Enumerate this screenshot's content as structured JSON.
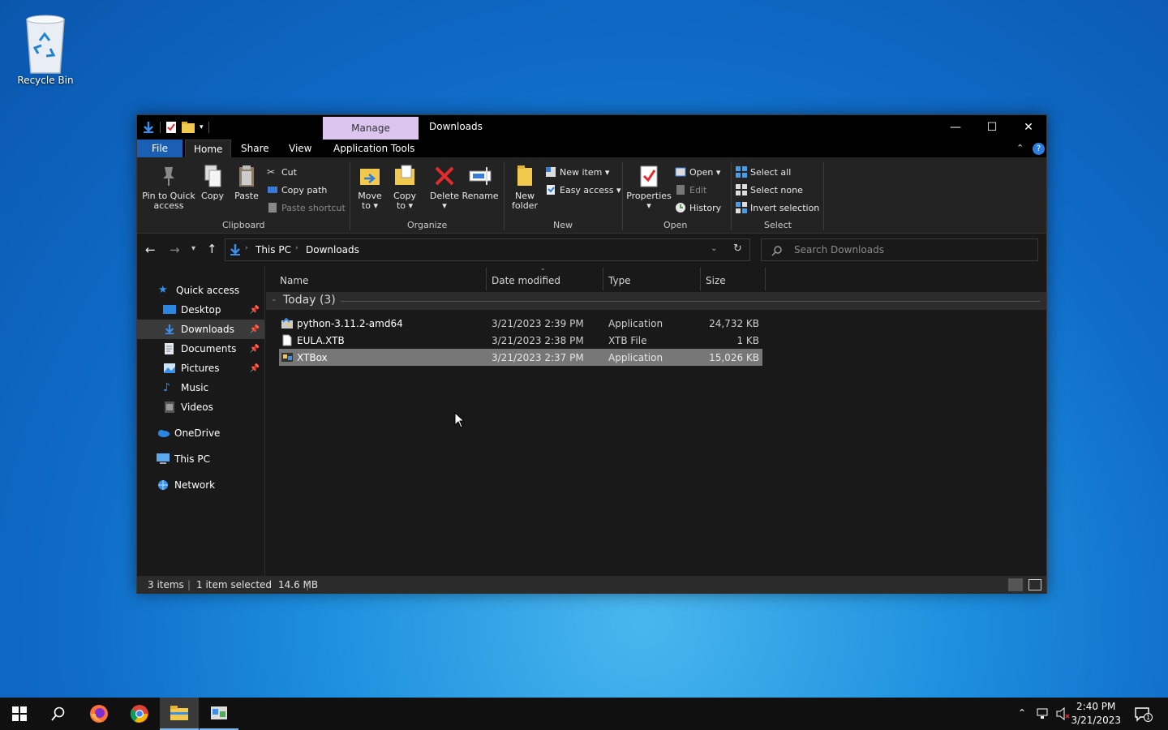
{
  "desktop": {
    "recycle_bin_label": "Recycle Bin"
  },
  "window": {
    "title": "Downloads",
    "context_tab": "Manage",
    "controls": {
      "minimize": "—",
      "maximize": "☐",
      "close": "✕"
    }
  },
  "ribbon_tabs": {
    "file": "File",
    "home": "Home",
    "share": "Share",
    "view": "View",
    "app_tools": "Application Tools"
  },
  "ribbon": {
    "clipboard": {
      "label": "Clipboard",
      "pin": "Pin to Quick\naccess",
      "copy": "Copy",
      "paste": "Paste",
      "cut": "Cut",
      "copy_path": "Copy path",
      "paste_shortcut": "Paste shortcut"
    },
    "organize": {
      "label": "Organize",
      "move_to": "Move\nto ▾",
      "copy_to": "Copy\nto ▾",
      "delete": "Delete\n▾",
      "rename": "Rename"
    },
    "new": {
      "label": "New",
      "new_folder": "New\nfolder",
      "new_item": "New item ▾",
      "easy_access": "Easy access ▾"
    },
    "open": {
      "label": "Open",
      "properties": "Properties\n▾",
      "open": "Open ▾",
      "edit": "Edit",
      "history": "History"
    },
    "select": {
      "label": "Select",
      "select_all": "Select all",
      "select_none": "Select none",
      "invert": "Invert selection"
    }
  },
  "address": {
    "crumbs": [
      "This PC",
      "Downloads"
    ],
    "search_placeholder": "Search Downloads"
  },
  "sidebar": {
    "items": [
      {
        "label": "Quick access"
      },
      {
        "label": "Desktop"
      },
      {
        "label": "Downloads"
      },
      {
        "label": "Documents"
      },
      {
        "label": "Pictures"
      },
      {
        "label": "Music"
      },
      {
        "label": "Videos"
      },
      {
        "label": "OneDrive"
      },
      {
        "label": "This PC"
      },
      {
        "label": "Network"
      }
    ]
  },
  "columns": {
    "name": "Name",
    "date": "Date modified",
    "type": "Type",
    "size": "Size"
  },
  "group": {
    "label": "Today (3)"
  },
  "files": [
    {
      "name": "python-3.11.2-amd64",
      "date": "3/21/2023 2:39 PM",
      "type": "Application",
      "size": "24,732 KB"
    },
    {
      "name": "EULA.XTB",
      "date": "3/21/2023 2:38 PM",
      "type": "XTB File",
      "size": "1 KB"
    },
    {
      "name": "XTBox",
      "date": "3/21/2023 2:37 PM",
      "type": "Application",
      "size": "15,026 KB"
    }
  ],
  "status": {
    "count": "3 items",
    "selected": "1 item selected",
    "size": "14.6 MB"
  },
  "taskbar": {
    "time": "2:40 PM",
    "date": "3/21/2023",
    "notif_count": "1"
  },
  "colors": {
    "accent": "#1a5fb4",
    "manage_tab": "#dcc6f0",
    "folder": "#f2c94c"
  }
}
